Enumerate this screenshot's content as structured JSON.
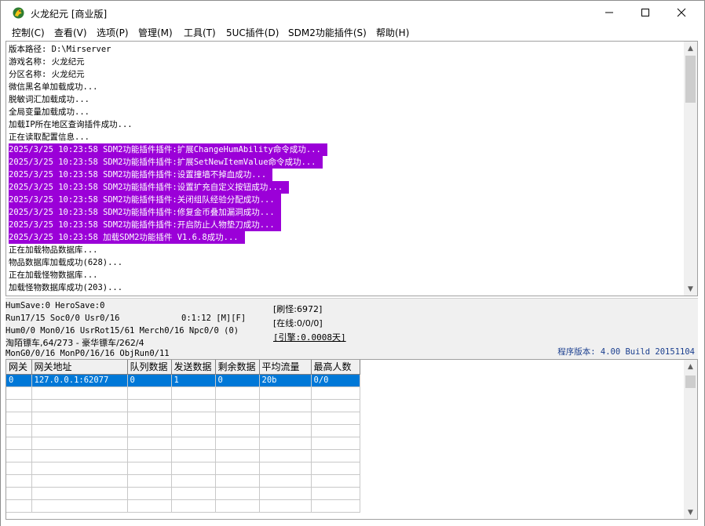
{
  "window": {
    "title": "火龙纪元 [商业版]"
  },
  "menu": [
    {
      "label": "控制(C)"
    },
    {
      "label": "查看(V)"
    },
    {
      "label": "选项(P)"
    },
    {
      "label": "管理(M)"
    },
    {
      "label": "工具(T)"
    },
    {
      "label": "5UC插件(D)"
    },
    {
      "label": "SDM2功能插件(S)"
    },
    {
      "label": "帮助(H)"
    }
  ],
  "log": [
    {
      "text": "版本路径: D:\\Mirserver",
      "highlight": false
    },
    {
      "text": "游戏名称: 火龙纪元",
      "highlight": false
    },
    {
      "text": "分区名称: 火龙纪元",
      "highlight": false
    },
    {
      "text": "微信黑名单加载成功...",
      "highlight": false
    },
    {
      "text": "脱敏词汇加载成功...",
      "highlight": false
    },
    {
      "text": "全局变量加载成功...",
      "highlight": false
    },
    {
      "text": "加载IP所在地区查询插件成功...",
      "highlight": false
    },
    {
      "text": "正在读取配置信息...",
      "highlight": false
    },
    {
      "text": "2025/3/25 10:23:58 SDM2功能插件插件:扩展ChangeHumAbility命令成功...",
      "highlight": true
    },
    {
      "text": "2025/3/25 10:23:58 SDM2功能插件插件:扩展SetNewItemValue命令成功...",
      "highlight": true
    },
    {
      "text": "2025/3/25 10:23:58 SDM2功能插件插件:设置撞墙不掉血成功...",
      "highlight": true
    },
    {
      "text": "2025/3/25 10:23:58 SDM2功能插件插件:设置扩充自定义按钮成功...",
      "highlight": true
    },
    {
      "text": "2025/3/25 10:23:58 SDM2功能插件插件:关闭组队经验分配成功...",
      "highlight": true
    },
    {
      "text": "2025/3/25 10:23:58 SDM2功能插件插件:修复金币叠加漏洞成功...",
      "highlight": true
    },
    {
      "text": "2025/3/25 10:23:58 SDM2功能插件插件:开启防止人物垫刀成功...",
      "highlight": true
    },
    {
      "text": "2025/3/25 10:23:58 加载SDM2功能插件 V1.6.8成功...",
      "highlight": true
    },
    {
      "text": "正在加载物品数据库...",
      "highlight": false
    },
    {
      "text": "物品数据库加载成功(628)...",
      "highlight": false
    },
    {
      "text": "正在加载怪物数据库...",
      "highlight": false
    },
    {
      "text": "加载怪物数据库成功(203)...",
      "highlight": false
    }
  ],
  "status": {
    "line1": "HumSave:0 HeroSave:0",
    "line2": "Run17/15 Soc0/0 Usr0/16",
    "time": "0:1:12 [M][F]",
    "line3": "Hum0/0 Mon0/16 UsrRot15/61 Merch0/16 Npc0/0 (0)",
    "line4": "淘陌镖车,64/273 - 豪华镖车/262/4",
    "line5": "MonG0/0/16 MonP0/16/16 ObjRun0/11",
    "refresh_monster": "[刷怪:6972]",
    "online": "[在线:0/0/0]",
    "engine": "[引擎:0.0008天]",
    "version": "程序版本: 4.00 Build 20151104"
  },
  "gateway_table": {
    "headers": [
      "网关",
      "网关地址",
      "队列数据",
      "发送数据",
      "剩余数据",
      "平均流量",
      "最高人数"
    ],
    "rows": [
      [
        "0",
        "127.0.0.1:62077",
        "0",
        "1",
        "0",
        "20b",
        "0/0"
      ]
    ]
  },
  "colors": {
    "log_highlight": "#9b00d8",
    "selection": "#0078d7",
    "version_text": "#1b3f8f"
  }
}
